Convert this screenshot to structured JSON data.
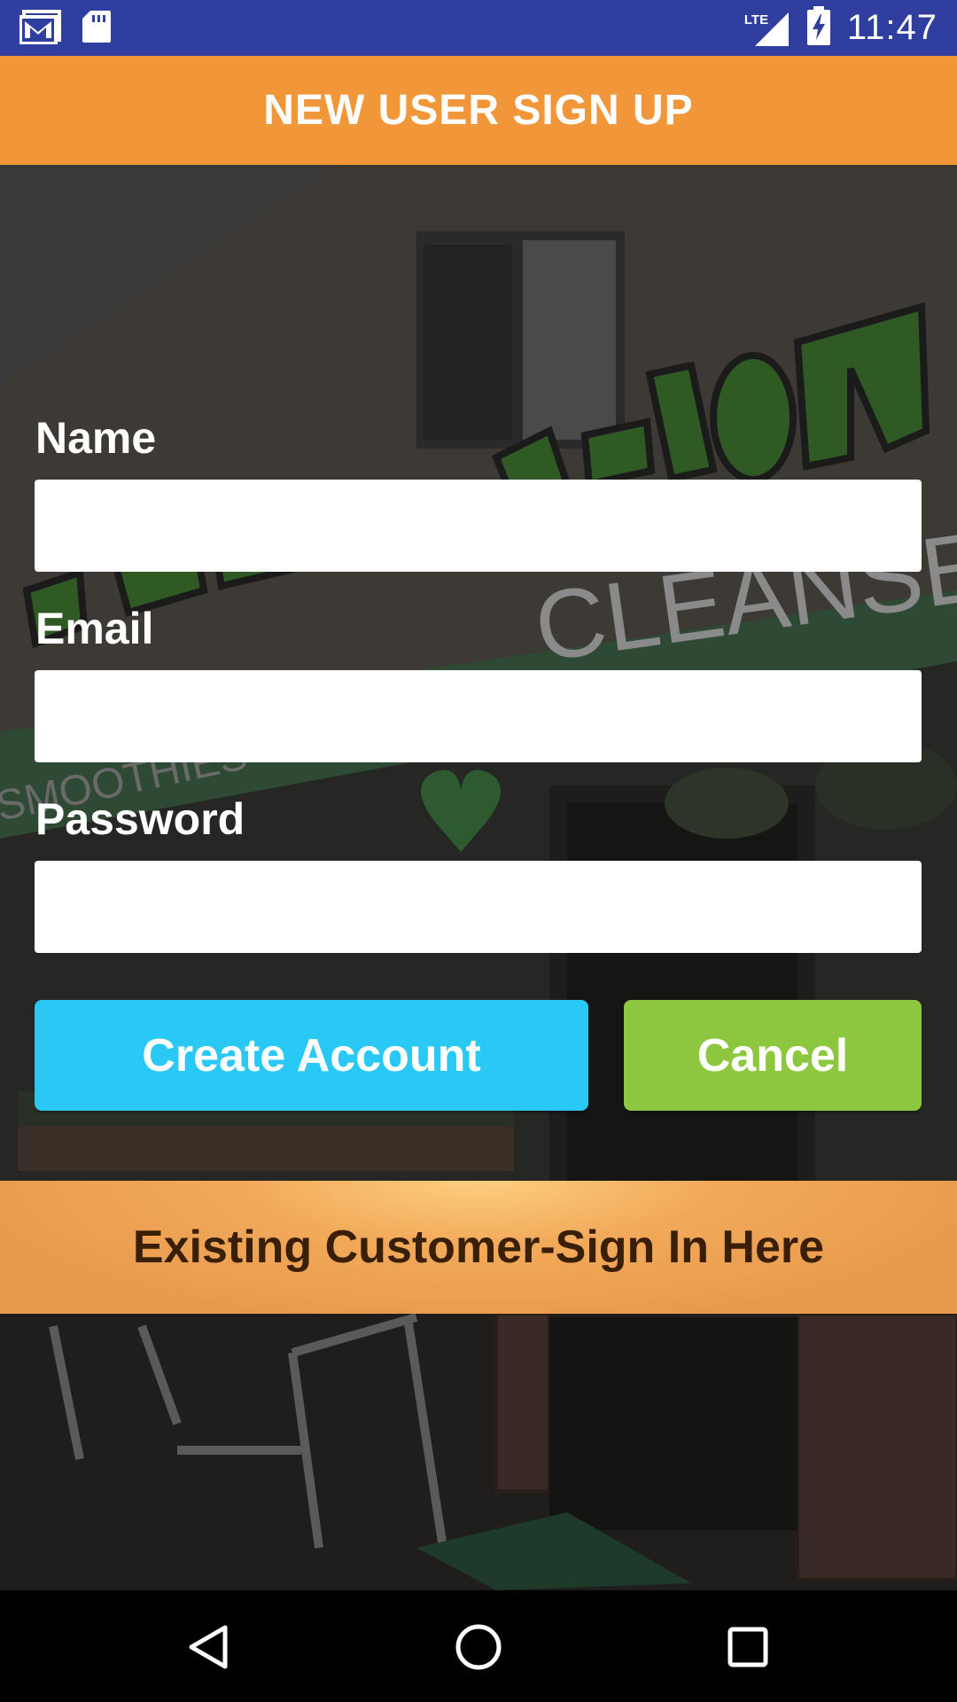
{
  "status_bar": {
    "time": "11:47",
    "network": "LTE",
    "icons": [
      "gmail-icon",
      "sd-card-icon",
      "lte-signal-icon",
      "battery-charging-icon"
    ]
  },
  "app_bar": {
    "title": "NEW USER SIGN UP"
  },
  "form": {
    "name": {
      "label": "Name",
      "value": "",
      "placeholder": ""
    },
    "email": {
      "label": "Email",
      "value": "",
      "placeholder": ""
    },
    "password": {
      "label": "Password",
      "value": "",
      "placeholder": ""
    }
  },
  "buttons": {
    "create_label": "Create Account",
    "cancel_label": "Cancel"
  },
  "signin": {
    "label": "Existing Customer-Sign In Here"
  },
  "background": {
    "sign_text": "JUICE THE VISION",
    "awning_text": "CLEANSES",
    "window_text": "SMOOTHIES"
  },
  "colors": {
    "status_bar": "#303F9F",
    "app_bar": "#F2963A",
    "create_button": "#29C8F5",
    "cancel_button": "#8DC63F",
    "signin_banner": "#F2A95A",
    "signin_text": "#3A1F08"
  },
  "nav_bar": {
    "icons": [
      "back-icon",
      "home-icon",
      "recents-icon"
    ]
  }
}
